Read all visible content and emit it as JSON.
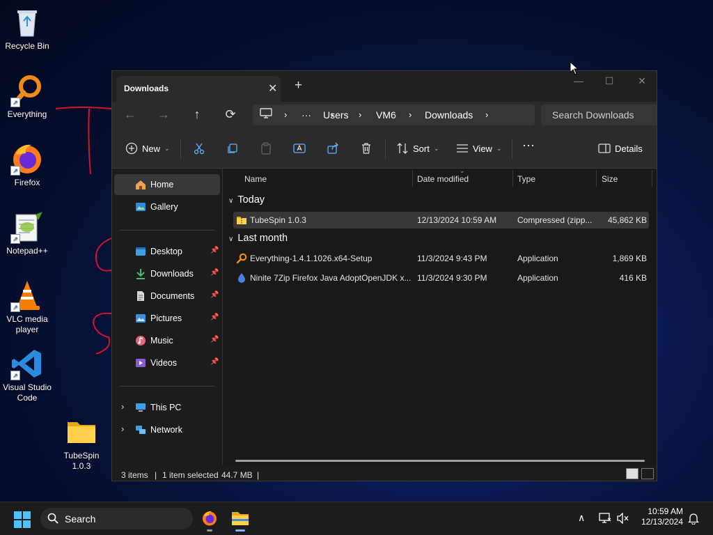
{
  "desktop": {
    "icons": [
      {
        "label": "Recycle Bin"
      },
      {
        "label": "Everything"
      },
      {
        "label": "Firefox"
      },
      {
        "label": "Notepad++"
      },
      {
        "label": "VLC media player"
      },
      {
        "label": "Visual Studio Code"
      },
      {
        "label": "TubeSpin 1.0.3"
      }
    ]
  },
  "explorer": {
    "tab_title": "Downloads",
    "address": {
      "segments": [
        "Users",
        "VM6",
        "Downloads"
      ],
      "search_placeholder": "Search Downloads"
    },
    "toolbar": {
      "new_label": "New",
      "sort_label": "Sort",
      "view_label": "View",
      "details_label": "Details"
    },
    "sidebar": {
      "top": [
        "Home",
        "Gallery"
      ],
      "pinned": [
        "Desktop",
        "Downloads",
        "Documents",
        "Pictures",
        "Music",
        "Videos"
      ],
      "bottom": [
        "This PC",
        "Network"
      ]
    },
    "columns": [
      "Name",
      "Date modified",
      "Type",
      "Size"
    ],
    "groups": [
      {
        "label": "Today",
        "files": [
          {
            "name": "TubeSpin 1.0.3",
            "date": "12/13/2024 10:59 AM",
            "type": "Compressed (zipp...",
            "size": "45,862 KB"
          }
        ]
      },
      {
        "label": "Last month",
        "files": [
          {
            "name": "Everything-1.4.1.1026.x64-Setup",
            "date": "11/3/2024 9:43 PM",
            "type": "Application",
            "size": "1,869 KB"
          },
          {
            "name": "Ninite 7Zip Firefox Java AdoptOpenJDK x...",
            "date": "11/3/2024 9:30 PM",
            "type": "Application",
            "size": "416 KB"
          }
        ]
      }
    ],
    "status": {
      "items": "3 items",
      "selected": "1 item selected",
      "size": "44.7 MB"
    }
  },
  "taskbar": {
    "search_label": "Search",
    "time": "10:59 AM",
    "date": "12/13/2024"
  },
  "colors": {
    "folder": "#f4c430",
    "accent": "#0a84ff"
  }
}
